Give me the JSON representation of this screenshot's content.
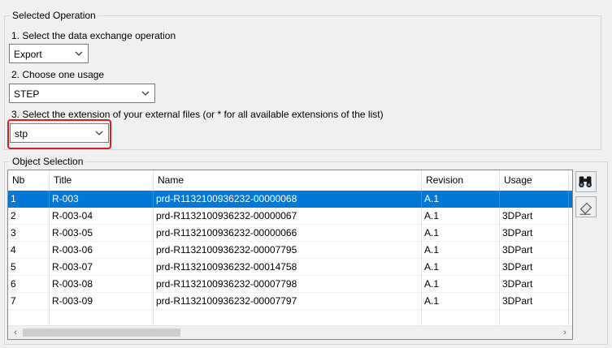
{
  "selected_operation": {
    "title": "Selected Operation",
    "step1_label": "1. Select the data exchange operation",
    "step1_value": "Export",
    "step2_label": "2. Choose one usage",
    "step2_value": "STEP",
    "step3_label": "3. Select the extension of your external files (or * for all available extensions of the list)",
    "step3_value": "stp",
    "highlight_color": "#d62020"
  },
  "object_selection": {
    "title": "Object Selection",
    "columns": [
      "Nb",
      "Title",
      "Name",
      "Revision",
      "Usage"
    ],
    "rows": [
      {
        "nb": "1",
        "title": "R-003",
        "name": "prd-R1132100936232-00000068",
        "revision": "A.1",
        "usage": "",
        "selected": true
      },
      {
        "nb": "2",
        "title": "R-003-04",
        "name": "prd-R1132100936232-00000067",
        "revision": "A.1",
        "usage": "3DPart"
      },
      {
        "nb": "3",
        "title": "R-003-05",
        "name": "prd-R1132100936232-00000066",
        "revision": "A.1",
        "usage": "3DPart"
      },
      {
        "nb": "4",
        "title": "R-003-06",
        "name": "prd-R1132100936232-00007795",
        "revision": "A.1",
        "usage": "3DPart"
      },
      {
        "nb": "5",
        "title": "R-003-07",
        "name": "prd-R1132100936232-00014758",
        "revision": "A.1",
        "usage": "3DPart"
      },
      {
        "nb": "6",
        "title": "R-003-08",
        "name": "prd-R1132100936232-00007798",
        "revision": "A.1",
        "usage": "3DPart"
      },
      {
        "nb": "7",
        "title": "R-003-09",
        "name": "prd-R1132100936232-00007797",
        "revision": "A.1",
        "usage": "3DPart"
      }
    ],
    "selection_color": "#0078d7",
    "side_buttons": [
      {
        "icon": "binoculars-icon"
      },
      {
        "icon": "eraser-icon"
      }
    ]
  }
}
